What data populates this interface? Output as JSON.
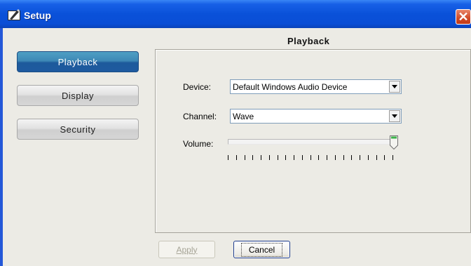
{
  "window": {
    "title": "Setup",
    "app_icon": "setup-pencil-icon",
    "close_icon": "close-icon",
    "close_symbol": "✕",
    "close_color": "#d04b27",
    "titlebar_color": "#0a51d9"
  },
  "sidebar": {
    "items": [
      {
        "label": "Playback",
        "active": true
      },
      {
        "label": "Display",
        "active": false
      },
      {
        "label": "Security",
        "active": false
      }
    ],
    "active_color": "#1d5a9b"
  },
  "panel": {
    "title": "Playback",
    "device": {
      "label": "Device:",
      "value": "Default Windows Audio Device"
    },
    "channel": {
      "label": "Channel:",
      "value": "Wave"
    },
    "volume": {
      "label": "Volume:",
      "level_fraction": 1.0,
      "tick_count": 21
    }
  },
  "buttons": {
    "apply": {
      "label": "Apply",
      "enabled": false
    },
    "cancel": {
      "label": "Cancel",
      "enabled": true
    }
  }
}
